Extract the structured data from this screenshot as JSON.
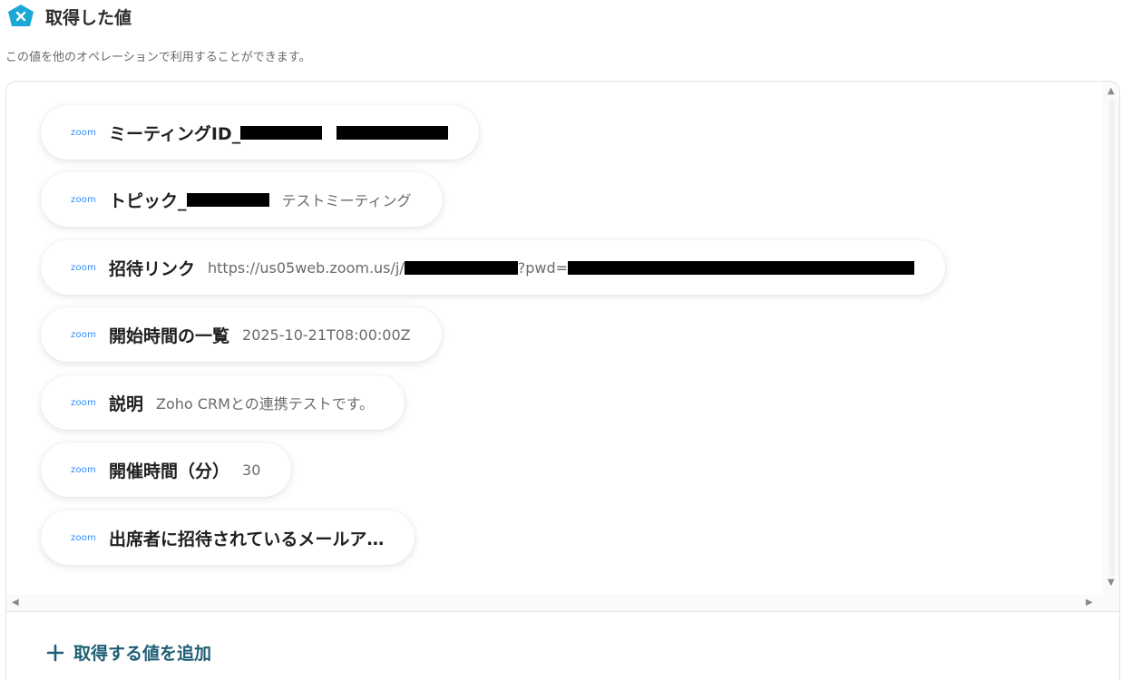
{
  "header": {
    "title": "取得した値",
    "icon": "x-badge-icon",
    "accent": "#1ba8d6"
  },
  "subtitle": "この値を他のオペレーションで利用することができます。",
  "values": [
    {
      "source": "zoom",
      "label": "ミーティングID_",
      "value": ""
    },
    {
      "source": "zoom",
      "label": "トピック_",
      "value": "テストミーティング"
    },
    {
      "source": "zoom",
      "label": "招待リンク",
      "value_prefix": "https://us05web.zoom.us/j/",
      "value_middle": "?pwd="
    },
    {
      "source": "zoom",
      "label": "開始時間の一覧",
      "value": "2025-10-21T08:00:00Z"
    },
    {
      "source": "zoom",
      "label": "説明",
      "value": "Zoho CRMとの連携テストです。"
    },
    {
      "source": "zoom",
      "label": "開催時間（分）",
      "value": "30"
    },
    {
      "source": "zoom",
      "label": "出席者に招待されているメールア…",
      "value": ""
    }
  ],
  "add_button": {
    "label": "取得する値を追加",
    "color": "#1e5e74"
  },
  "zoom_brand_color": "#2d8cff"
}
